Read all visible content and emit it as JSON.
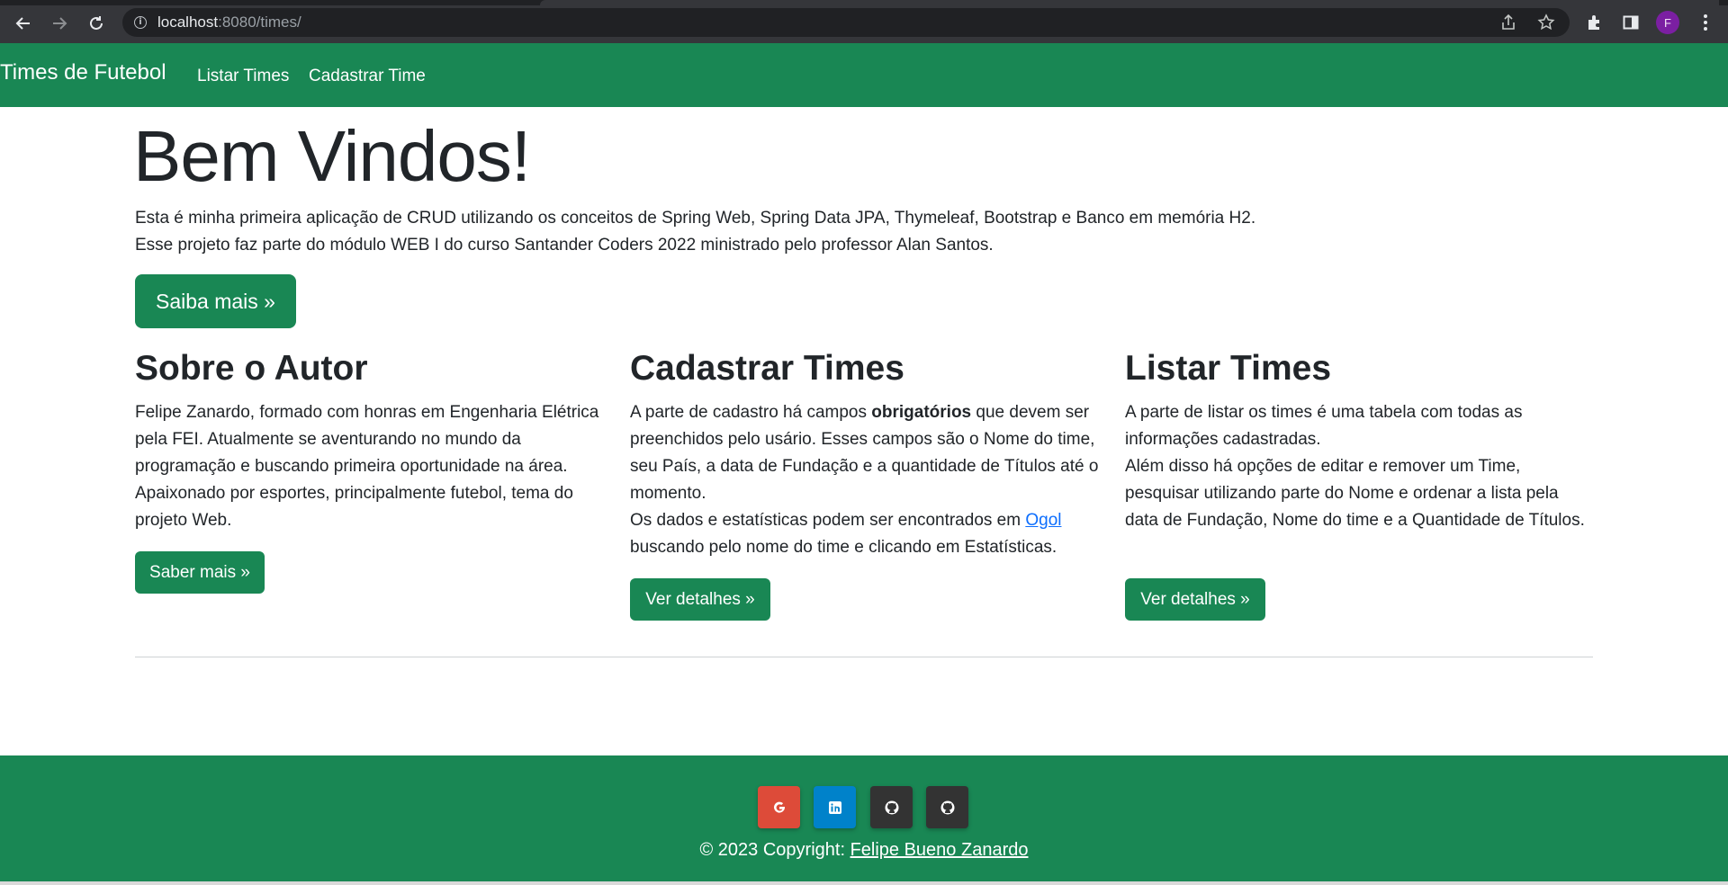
{
  "browser": {
    "url_host": "localhost",
    "url_path": ":8080/times/",
    "profile_initial": "F"
  },
  "navbar": {
    "brand": "Times de Futebol",
    "links": [
      "Listar Times",
      "Cadastrar Time"
    ]
  },
  "hero": {
    "title": "Bem Vindos!",
    "line1": "Esta é minha primeira aplicação de CRUD utilizando os conceitos de Spring Web, Spring Data JPA, Thymeleaf, Bootstrap e Banco em memória H2.",
    "line2": "Esse projeto faz parte do módulo WEB I do curso Santander Coders 2022 ministrado pelo professor Alan Santos.",
    "button": "Saiba mais »"
  },
  "columns": [
    {
      "title": "Sobre o Autor",
      "text": "Felipe Zanardo, formado com honras em Engenharia Elétrica pela FEI. Atualmente se aventurando no mundo da programação e buscando primeira oportunidade na área. Apaixonado por esportes, principalmente futebol, tema do projeto Web.",
      "button": "Saber mais »"
    },
    {
      "title": "Cadastrar Times",
      "text_before_bold": "A parte de cadastro há campos ",
      "text_bold": "obrigatórios",
      "text_after_bold": " que devem ser preenchidos pelo usário. Esses campos são o Nome do time, seu País, a data de Fundação e a quantidade de Títulos até o momento.",
      "text2_before_link": "Os dados e estatísticas podem ser encontrados em ",
      "text2_link": "Ogol",
      "text2_after_link": " buscando pelo nome do time e clicando em Estatísticas.",
      "button": "Ver detalhes »"
    },
    {
      "title": "Listar Times",
      "text": "A parte de listar os times é uma tabela com todas as informações cadastradas.",
      "text2": "Além disso há opções de editar e remover um Time, pesquisar utilizando parte do Nome e ordenar a lista pela data de Fundação, Nome do time e a Quantidade de Títulos.",
      "button": "Ver detalhes »"
    }
  ],
  "footer": {
    "social": [
      {
        "name": "google",
        "glyph": "G",
        "color": "#dd4b39"
      },
      {
        "name": "linkedin",
        "glyph": "in",
        "color": "#0082ca"
      },
      {
        "name": "github",
        "glyph": "gh",
        "color": "#333333"
      },
      {
        "name": "github",
        "glyph": "gh",
        "color": "#333333"
      }
    ],
    "copyright_prefix": "© 2023 Copyright: ",
    "copyright_link": "Felipe Bueno Zanardo"
  },
  "colors": {
    "brand_green": "#198754",
    "link_blue": "#0d6efd"
  }
}
